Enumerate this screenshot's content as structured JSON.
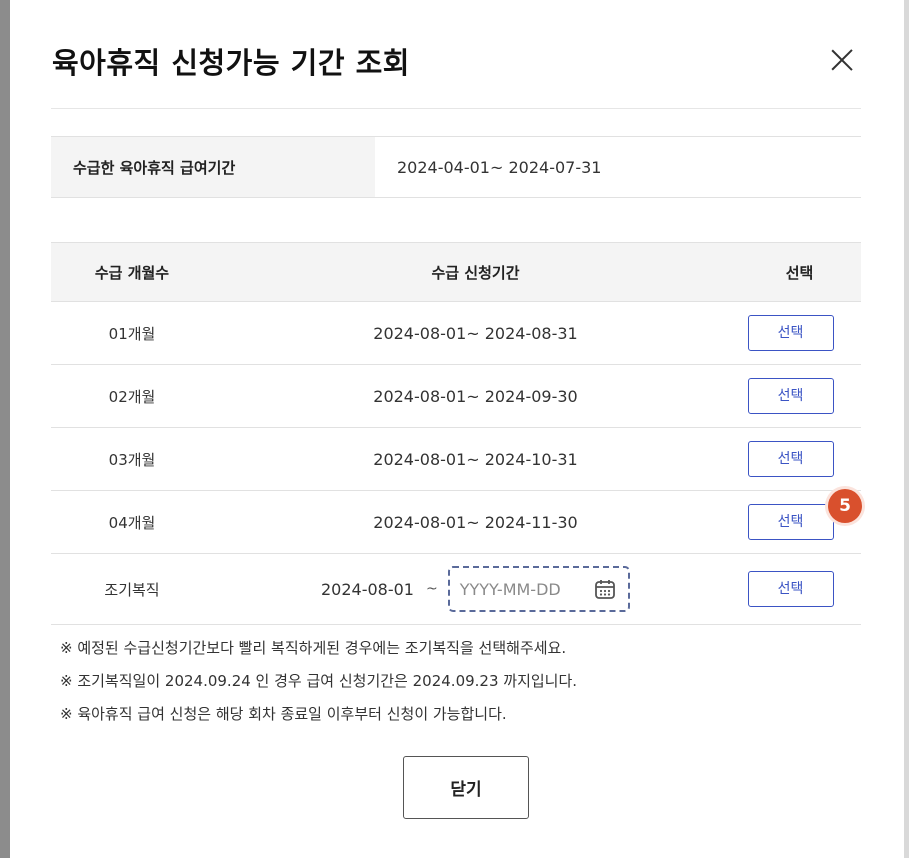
{
  "modal": {
    "title": "육아휴직 신청가능 기간 조회",
    "close_main_label": "닫기"
  },
  "received_period": {
    "label": "수급한 육아휴직 급여기간",
    "value": "2024-04-01~ 2024-07-31"
  },
  "table": {
    "headers": [
      "수급 개월수",
      "수급 신청기간",
      "선택"
    ],
    "rows": [
      {
        "months": "01개월",
        "period": "2024-08-01~ 2024-08-31",
        "button": "선택"
      },
      {
        "months": "02개월",
        "period": "2024-08-01~ 2024-09-30",
        "button": "선택"
      },
      {
        "months": "03개월",
        "period": "2024-08-01~ 2024-10-31",
        "button": "선택"
      },
      {
        "months": "04개월",
        "period": "2024-08-01~ 2024-11-30",
        "button": "선택"
      }
    ],
    "early": {
      "label": "조기복직",
      "start": "2024-08-01",
      "tilde": "~",
      "date_placeholder": "YYYY-MM-DD",
      "button": "선택"
    }
  },
  "badge": {
    "value": "5",
    "color": "#d9502d"
  },
  "notes": [
    "※ 예정된 수급신청기간보다 빨리 복직하게된 경우에는 조기복직을 선택해주세요.",
    "※ 조기복직일이 2024.09.24 인 경우 급여 신청기간은 2024.09.23 까지입니다.",
    "※ 육아휴직 급여 신청은 해당 회차 종료일 이후부터 신청이 가능합니다."
  ],
  "colors": {
    "accent": "#3b54c4",
    "header_bg": "#f4f4f4",
    "border": "#e1e1e1"
  }
}
